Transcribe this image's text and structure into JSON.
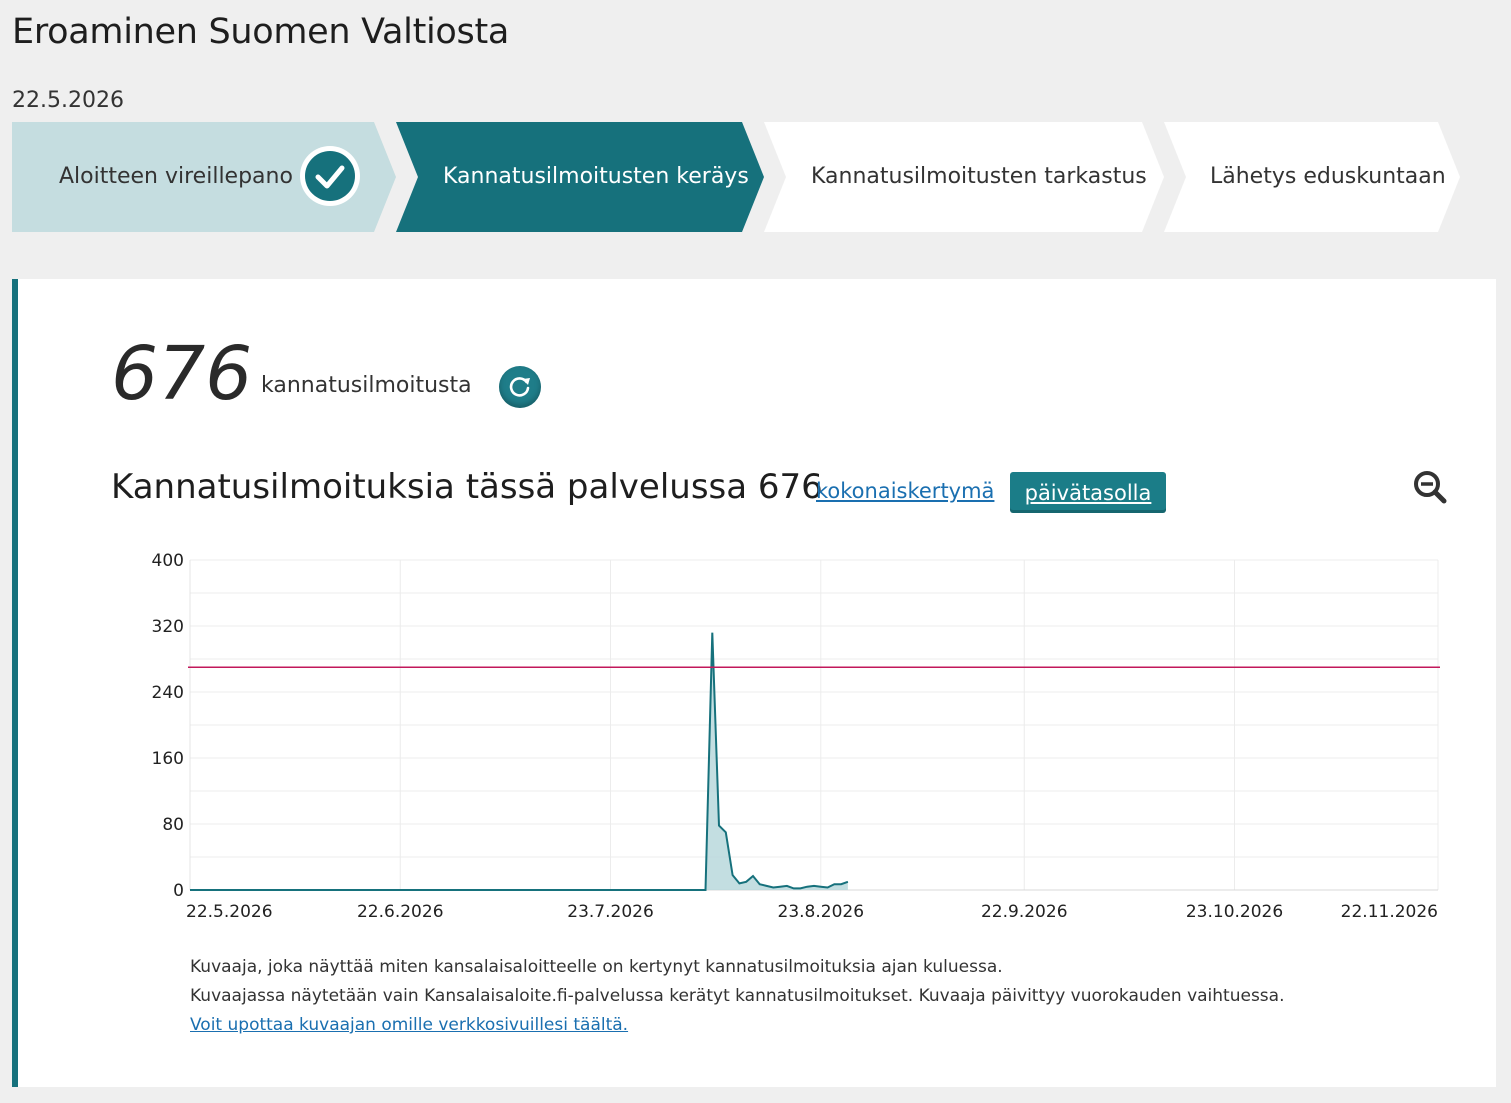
{
  "page": {
    "title": "Eroaminen Suomen Valtiosta",
    "date": "22.5.2026"
  },
  "steps": [
    {
      "label": "Aloitteen vireillepano",
      "state": "done"
    },
    {
      "label": "Kannatusilmoitusten keräys",
      "state": "active"
    },
    {
      "label": "Kannatusilmoitusten tarkastus",
      "state": "pending"
    },
    {
      "label": "Lähetys eduskuntaan",
      "state": "pending"
    }
  ],
  "summary": {
    "count": "676",
    "count_label": "kannatusilmoitusta"
  },
  "chart_header": {
    "title": "Kannatusilmoituksia tässä palvelussa 676",
    "link_total": "kokonaiskertymä",
    "button_daily": "päivätasolla"
  },
  "colors": {
    "accent": "#16717c",
    "step_done": "#c5dde0",
    "line": "#16717c",
    "fill": "#b9d8dc",
    "threshold": "#c2185b"
  },
  "chart_data": {
    "type": "area",
    "title": "",
    "xlabel": "",
    "ylabel": "",
    "ylim": [
      0,
      400
    ],
    "y_ticks": [
      0,
      80,
      160,
      240,
      320,
      400
    ],
    "x_tick_labels": [
      "22.5.2026",
      "22.6.2026",
      "23.7.2026",
      "23.8.2026",
      "22.9.2026",
      "23.10.2026",
      "22.11.2026"
    ],
    "x_tick_dates": [
      "2026-05-22",
      "2026-06-22",
      "2026-07-23",
      "2026-08-23",
      "2026-09-22",
      "2026-10-23",
      "2026-11-22"
    ],
    "x_range": [
      "2026-05-22",
      "2026-11-22"
    ],
    "threshold": 270,
    "grid": true,
    "series": [
      {
        "points": [
          [
            "2026-05-22",
            0
          ],
          [
            "2026-08-05",
            0
          ],
          [
            "2026-08-06",
            0
          ],
          [
            "2026-08-07",
            312
          ],
          [
            "2026-08-08",
            78
          ],
          [
            "2026-08-09",
            70
          ],
          [
            "2026-08-10",
            18
          ],
          [
            "2026-08-11",
            8
          ],
          [
            "2026-08-12",
            10
          ],
          [
            "2026-08-13",
            17
          ],
          [
            "2026-08-14",
            7
          ],
          [
            "2026-08-15",
            5
          ],
          [
            "2026-08-16",
            3
          ],
          [
            "2026-08-17",
            4
          ],
          [
            "2026-08-18",
            5
          ],
          [
            "2026-08-19",
            2
          ],
          [
            "2026-08-20",
            2
          ],
          [
            "2026-08-21",
            4
          ],
          [
            "2026-08-22",
            5
          ],
          [
            "2026-08-23",
            4
          ],
          [
            "2026-08-24",
            3
          ],
          [
            "2026-08-25",
            7
          ],
          [
            "2026-08-26",
            7
          ],
          [
            "2026-08-27",
            10
          ]
        ]
      }
    ]
  },
  "captions": {
    "line1": "Kuvaaja, joka näyttää miten kansalaisaloitteelle on kertynyt kannatusilmoituksia ajan kuluessa.",
    "line2": "Kuvaajassa näytetään vain Kansalaisaloite.fi-palvelussa kerätyt kannatusilmoitukset. Kuvaaja päivittyy vuorokauden vaihtuessa.",
    "embed_link": "Voit upottaa kuvaajan omille verkkosivuillesi täältä."
  }
}
